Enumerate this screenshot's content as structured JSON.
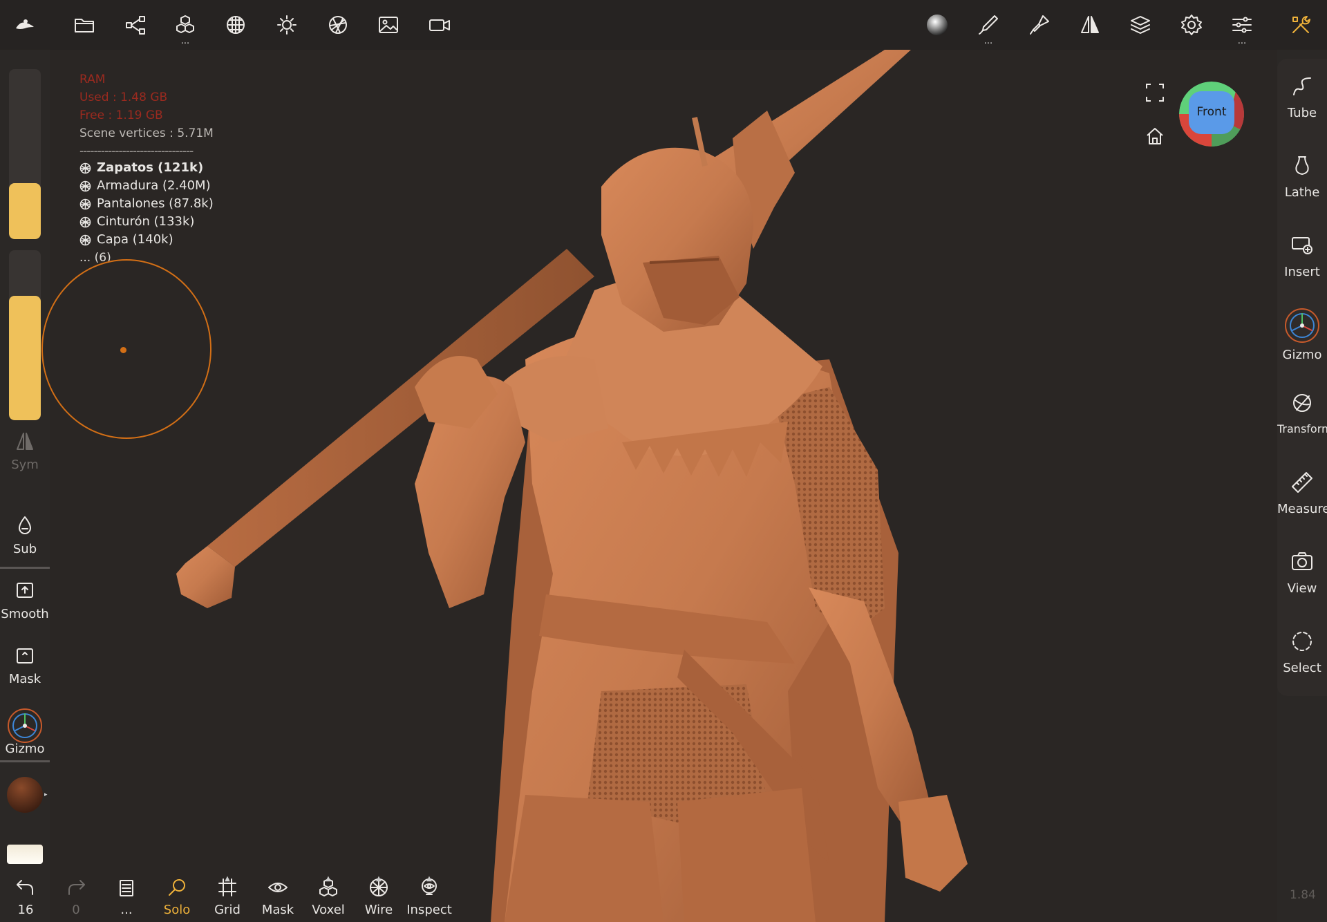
{
  "toolbar": {
    "left_icons": [
      "app-logo-icon",
      "folder-icon",
      "share-graph-icon",
      "scene-objects-icon",
      "topology-icon",
      "light-icon",
      "material-sphere-icon",
      "background-image-icon",
      "video-camera-icon"
    ],
    "right_icons": [
      "matcap-preview-icon",
      "brush-tool-icon",
      "paint-tool-icon",
      "symmetry-icon",
      "layers-icon",
      "settings-icon",
      "sliders-icon",
      "tools-icon"
    ]
  },
  "stats": {
    "ram_label": "RAM",
    "used": "Used : 1.48 GB",
    "free": "Free : 1.19 GB",
    "vertices": "Scene vertices : 5.71M",
    "separator": "--------------------------------"
  },
  "objects": [
    {
      "label": "Zapatos (121k)",
      "selected": true
    },
    {
      "label": "Armadura (2.40M)",
      "selected": false
    },
    {
      "label": "Pantalones (87.8k)",
      "selected": false
    },
    {
      "label": "Cinturón (133k)",
      "selected": false
    },
    {
      "label": "Capa (140k)",
      "selected": false
    }
  ],
  "objects_more": "... (6)",
  "left_panel": {
    "radius_level": 0.33,
    "intensity_level": 0.73,
    "sym": "Sym",
    "sub": "Sub",
    "smooth": "Smooth",
    "mask": "Mask",
    "gizmo": "Gizmo"
  },
  "right_panel": {
    "tube": "Tube",
    "lathe": "Lathe",
    "insert": "Insert",
    "gizmo": "Gizmo",
    "transform": "Transform",
    "measure": "Measure",
    "view": "View",
    "select": "Select"
  },
  "view_cube": {
    "face": "Front",
    "colors": {
      "top": "#5fd07a",
      "left": "#d9463b",
      "right": "#b8393a",
      "bottom": "#4f9d5a",
      "front": "#5a9ae8"
    }
  },
  "bottom": {
    "undo_count": "16",
    "redo_count": "0",
    "history_dots": "...",
    "solo": "Solo",
    "grid": "Grid",
    "mask": "Mask",
    "voxel": "Voxel",
    "wire": "Wire",
    "inspect": "Inspect"
  },
  "fps": "1.84",
  "colors": {
    "accent": "#efc15a",
    "brush": "#d36f16",
    "sculpt": "#c67a4e"
  }
}
